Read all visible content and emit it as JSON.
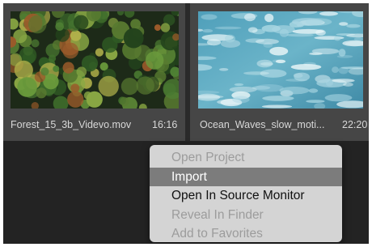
{
  "clips": [
    {
      "name": "Forest_15_3b_Videvo.mov",
      "duration": "16:16",
      "thumbnail": "forest-aerial"
    },
    {
      "name": "Ocean_Waves_slow_moti...",
      "duration": "22:20",
      "thumbnail": "ocean-waves"
    }
  ],
  "context_menu": {
    "items": [
      {
        "label": "Open Project",
        "state": "disabled"
      },
      {
        "label": "Import",
        "state": "highlighted"
      },
      {
        "label": "Open In Source Monitor",
        "state": "enabled"
      },
      {
        "label": "Reveal In Finder",
        "state": "disabled"
      },
      {
        "label": "Add to Favorites",
        "state": "disabled"
      }
    ]
  },
  "colors": {
    "panel_background": "#232323",
    "tile_background": "#464646",
    "menu_background": "#d4d4d4",
    "menu_highlight": "#7c7c7c"
  }
}
